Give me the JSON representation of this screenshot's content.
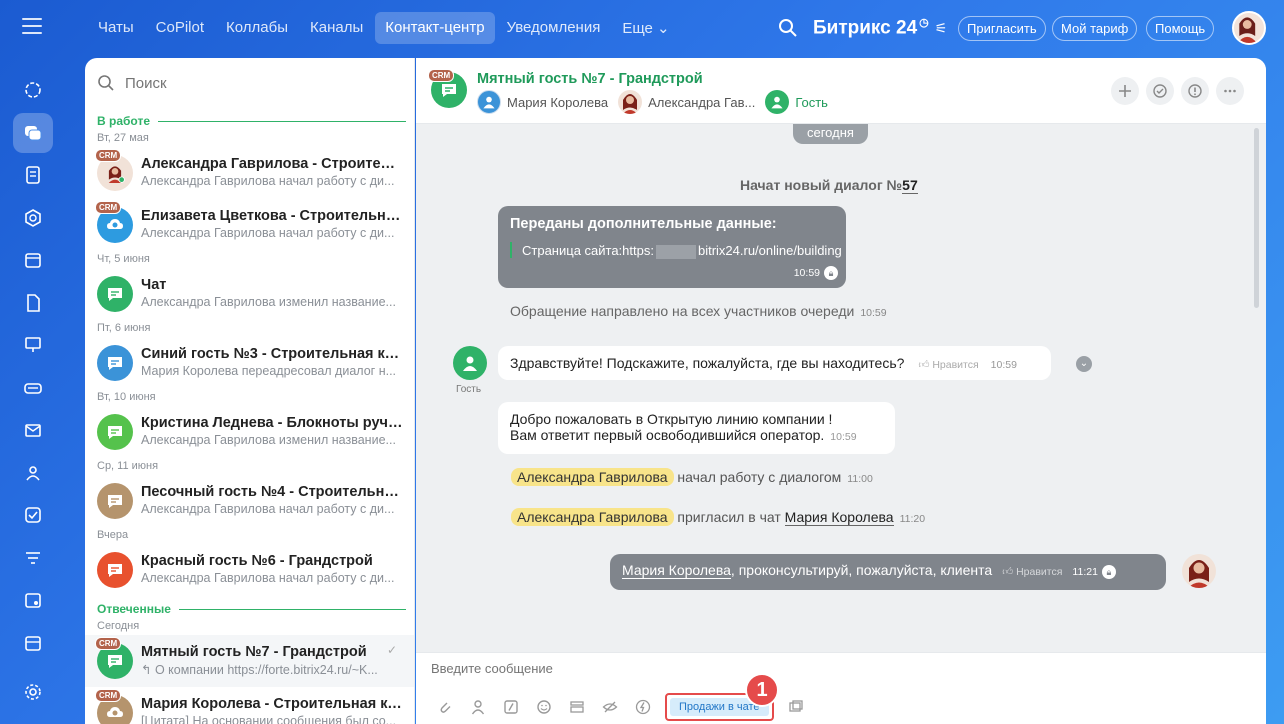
{
  "topbar": {
    "nav": [
      "Чаты",
      "CoPilot",
      "Коллабы",
      "Каналы",
      "Контакт-центр",
      "Уведомления",
      "Еще ⌄"
    ],
    "active_nav": "Контакт-центр",
    "logo": "Битрикс 24",
    "invite": "Пригласить",
    "tariff": "Мой тариф",
    "help": "Помощь"
  },
  "appbar": {
    "icons": [
      "activity-icon",
      "chats-icon",
      "feed-icon",
      "hexagon-icon",
      "calendar-icon",
      "document-icon",
      "presentation-icon",
      "contact-center-icon",
      "mail-icon",
      "group-icon",
      "tasks-icon",
      "filter-icon",
      "schedule-icon",
      "store-icon"
    ],
    "settings": "gear-icon"
  },
  "list": {
    "search_placeholder": "Поиск",
    "sections": {
      "in_work": "В работе",
      "answered": "Отвеченные"
    },
    "groups": [
      {
        "date": "Вт, 27 мая",
        "items": [
          {
            "title": "Александра Гаврилова - Строительн...",
            "snippet": "Александра Гаврилова начал работу с ди...",
            "crm": "CRM",
            "avatar": "photo"
          },
          {
            "title": "Елизавета Цветкова - Строительная ...",
            "snippet": "Александра Гаврилова начал работу с ди...",
            "crm": "CRM",
            "avatar": "cloud"
          }
        ]
      },
      {
        "date": "Чт, 5 июня",
        "items": [
          {
            "title": "Чат",
            "snippet": "Александра Гаврилова изменил название...",
            "avatar": "green"
          }
        ]
      },
      {
        "date": "Пт, 6 июня",
        "items": [
          {
            "title": "Синий гость №3 - Строительная ком...",
            "snippet": "Мария Королева переадресовал диалог н...",
            "avatar": "blue"
          }
        ]
      },
      {
        "date": "Вт, 10 июня",
        "items": [
          {
            "title": "Кристина Леднева - Блокноты ручно...",
            "snippet": "Александра Гаврилова изменил название...",
            "avatar": "lime"
          }
        ]
      },
      {
        "date": "Ср, 11 июня",
        "items": [
          {
            "title": "Песочный гость №4 - Строительная ...",
            "snippet": "Александра Гаврилова начал работу с ди...",
            "avatar": "sand"
          }
        ]
      },
      {
        "date": "Вчера",
        "items": [
          {
            "title": "Красный гость №6 - Грандстрой",
            "snippet": "Александра Гаврилова начал работу с ди...",
            "avatar": "red"
          }
        ]
      }
    ],
    "answered_date": "Сегодня",
    "answered_items": [
      {
        "title": "Мятный гость №7 - Грандстрой",
        "snippet": "↰ О компании https://forte.bitrix24.ru/~K...",
        "crm": "CRM",
        "avatar": "mint"
      },
      {
        "title": "Мария Королева - Строительная ко...",
        "snippet": "[Цитата] На основании сообщения был со...",
        "crm": "CRM",
        "avatar": "sand-cloud"
      }
    ]
  },
  "chat": {
    "crm": "CRM",
    "title": "Мятный гость №7 - Грандстрой",
    "members": [
      "Мария Королева",
      "Александра Гав...",
      "Гость"
    ],
    "day": "сегодня",
    "new_dialog": "Начат новый диалог №",
    "dialog_no": "57",
    "extra_title": "Переданы дополнительные данные:",
    "extra_text_a": "Страница сайта:https:",
    "extra_text_b": "bitrix24.ru/online/building",
    "extra_time": "10:59",
    "queue": "Обращение направлено на всех участников очереди",
    "queue_time": "10:59",
    "guest_label": "Гость",
    "msg1": "Здравствуйте! Подскажите, пожалуйста, где вы находитесь?",
    "like": "Нравится",
    "msg1_time": "10:59",
    "msg2_line1": "Добро пожаловать в Открытую линию компании !",
    "msg2_line2": "Вам ответит первый освободившийся оператор.",
    "msg2_time": "10:59",
    "op_name": "Александра Гаврилова",
    "started": "начал работу с диалогом",
    "started_time": "11:00",
    "invited": "пригласил в чат",
    "invited_name": "Мария Королева",
    "invited_time": "11:20",
    "out_mention": "Мария Королева",
    "out_text": ", проконсультируй, пожалуйста, клиента",
    "out_like": "Нравится",
    "out_time": "11:21",
    "input_placeholder": "Введите сообщение",
    "sales_button": "Продажи в чате",
    "badge": "1"
  },
  "colors": {
    "accent": "#2fb268",
    "brand": "#2f78ea",
    "highlight": "#e54b4b"
  }
}
